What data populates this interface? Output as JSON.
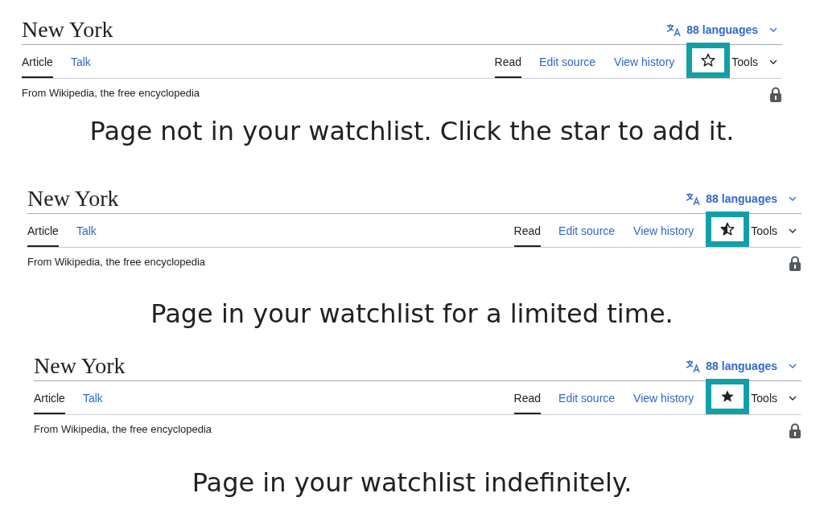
{
  "panels": [
    {
      "title": "New York",
      "languages": "88 languages",
      "left_tabs": [
        {
          "label": "Article",
          "selected": true
        },
        {
          "label": "Talk",
          "selected": false
        }
      ],
      "right_tabs": [
        {
          "label": "Read",
          "selected": true
        },
        {
          "label": "Edit source",
          "selected": false
        },
        {
          "label": "View history",
          "selected": false
        }
      ],
      "watched": false,
      "tools": "Tools",
      "tagline": "From Wikipedia, the free encyclopedia",
      "caption": "Page not in your watchlist. Click the star to add it."
    },
    {
      "title": "New York",
      "languages": "88 languages",
      "left_tabs": [
        {
          "label": "Article",
          "selected": true
        },
        {
          "label": "Talk",
          "selected": false
        }
      ],
      "right_tabs": [
        {
          "label": "Read",
          "selected": true
        },
        {
          "label": "Edit source",
          "selected": false
        },
        {
          "label": "View history",
          "selected": false
        }
      ],
      "watched": true,
      "expiring": true,
      "tools": "Tools",
      "tagline": "From Wikipedia, the free encyclopedia",
      "caption": "Page in your watchlist for a limited time."
    },
    {
      "title": "New York",
      "languages": "88 languages",
      "left_tabs": [
        {
          "label": "Article",
          "selected": true
        },
        {
          "label": "Talk",
          "selected": false
        }
      ],
      "right_tabs": [
        {
          "label": "Read",
          "selected": true
        },
        {
          "label": "Edit source",
          "selected": false
        },
        {
          "label": "View history",
          "selected": false
        }
      ],
      "watched": true,
      "expiring": false,
      "tools": "Tools",
      "tagline": "From Wikipedia, the free encyclopedia",
      "caption": "Page in your watchlist indefinitely."
    }
  ]
}
